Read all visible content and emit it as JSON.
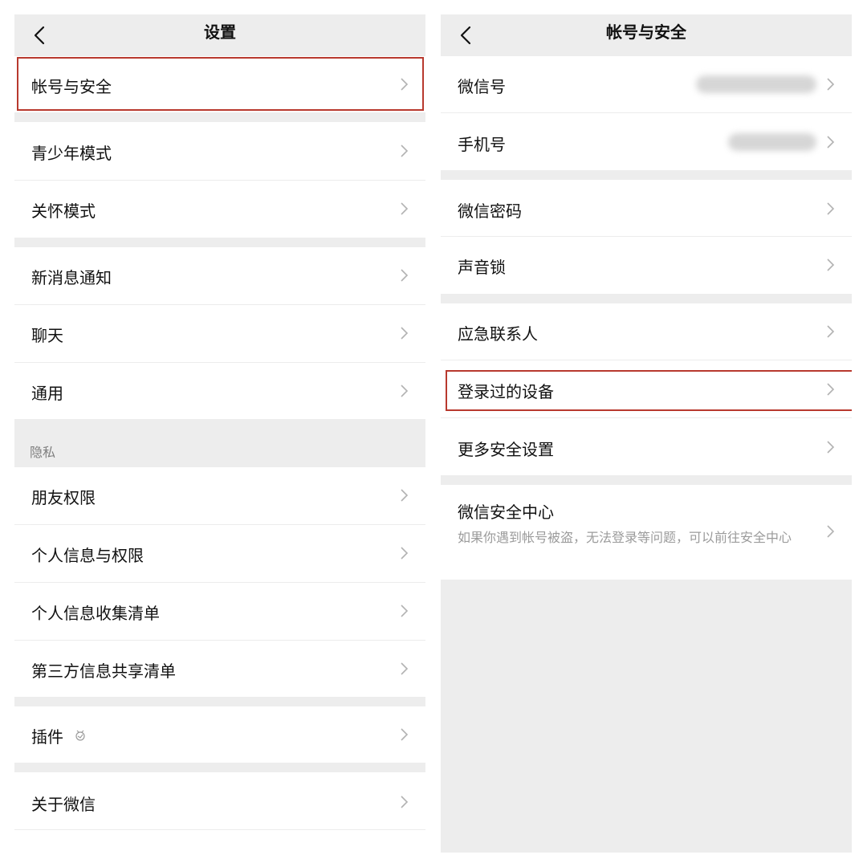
{
  "left": {
    "title": "设置",
    "items": {
      "account_security": "帐号与安全",
      "teen_mode": "青少年模式",
      "care_mode": "关怀模式",
      "new_message": "新消息通知",
      "chat": "聊天",
      "general": "通用",
      "friends_permission": "朋友权限",
      "personal_info_permission": "个人信息与权限",
      "personal_info_collection": "个人信息收集清单",
      "third_party_sharing": "第三方信息共享清单",
      "plugins": "插件",
      "about": "关于微信"
    },
    "section_privacy": "隐私"
  },
  "right": {
    "title": "帐号与安全",
    "items": {
      "wechat_id": "微信号",
      "phone": "手机号",
      "password": "微信密码",
      "voice_lock": "声音锁",
      "emergency_contact": "应急联系人",
      "logged_devices": "登录过的设备",
      "more_security": "更多安全设置",
      "security_center": "微信安全中心",
      "security_center_desc": "如果你遇到帐号被盗，无法登录等问题，可以前往安全中心"
    }
  },
  "colors": {
    "highlight": "#b8392e",
    "background": "#ededed"
  }
}
